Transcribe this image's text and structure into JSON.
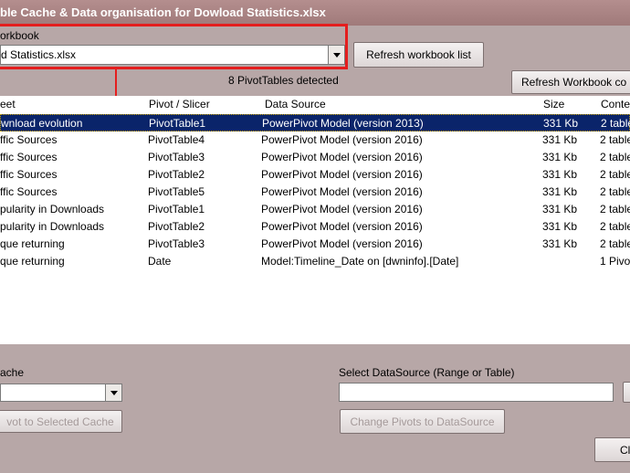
{
  "window": {
    "title": "ble Cache & Data organisation for Dowload Statistics.xlsx"
  },
  "workbook": {
    "label": "orkbook",
    "selected": "d Statistics.xlsx",
    "pivot_count_text": "8 PivotTables detected"
  },
  "buttons": {
    "refresh_list": "Refresh workbook list",
    "refresh_workbook": "Refresh  Workbook co",
    "change_to_cache": "vot to Selected Cache",
    "change_to_datasource": "Change Pivots to DataSource",
    "close": "Cl"
  },
  "table": {
    "columns": [
      "eet",
      "Pivot / Slicer",
      "Data Source",
      "Size",
      "Conte"
    ],
    "rows": [
      [
        "wnload evolution",
        "PivotTable1",
        "PowerPivot Model (version 2013)",
        "331 Kb",
        "2 table"
      ],
      [
        "ffic Sources",
        "PivotTable4",
        "PowerPivot Model (version 2016)",
        "331 Kb",
        "2 table"
      ],
      [
        "ffic Sources",
        "PivotTable3",
        "PowerPivot Model (version 2016)",
        "331 Kb",
        "2 table"
      ],
      [
        "ffic Sources",
        "PivotTable2",
        "PowerPivot Model (version 2016)",
        "331 Kb",
        "2 table"
      ],
      [
        "ffic Sources",
        "PivotTable5",
        "PowerPivot Model (version 2016)",
        "331 Kb",
        "2 table"
      ],
      [
        "pularity in Downloads",
        "PivotTable1",
        "PowerPivot Model (version 2016)",
        "331 Kb",
        "2 table"
      ],
      [
        "pularity in Downloads",
        "PivotTable2",
        "PowerPivot Model (version 2016)",
        "331 Kb",
        "2 table"
      ],
      [
        "que  returning",
        "PivotTable3",
        "PowerPivot Model (version 2016)",
        "331 Kb",
        "2 table"
      ],
      [
        "que  returning",
        "Date",
        "Model:Timeline_Date on [dwninfo].[Date]",
        "",
        "1 Pivo"
      ]
    ]
  },
  "cache": {
    "label": "ache",
    "value": ""
  },
  "datasource": {
    "label": "Select DataSource (Range or Table)",
    "value": ""
  }
}
